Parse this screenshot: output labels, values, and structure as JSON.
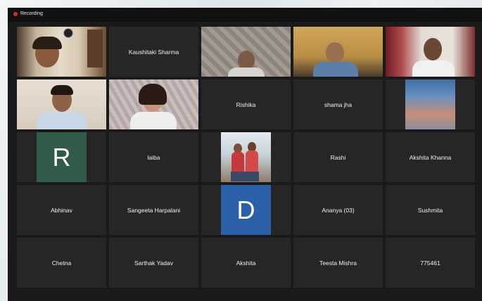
{
  "recording": {
    "label": "Recording"
  },
  "colors": {
    "active_border": "#8bc33f",
    "tile_bg": "#262626",
    "avatar_R": "#2f5b48",
    "avatar_D": "#2b5fa8",
    "recording_dot": "#e02828"
  },
  "tiles": [
    {
      "kind": "video",
      "name": ""
    },
    {
      "kind": "name",
      "name": "Kaushitaki Sharma"
    },
    {
      "kind": "video",
      "name": ""
    },
    {
      "kind": "video",
      "name": ""
    },
    {
      "kind": "video",
      "name": ""
    },
    {
      "kind": "video",
      "name": ""
    },
    {
      "kind": "video",
      "name": ""
    },
    {
      "kind": "name",
      "name": "Rishika"
    },
    {
      "kind": "name",
      "name": "shama jha"
    },
    {
      "kind": "image",
      "name": ""
    },
    {
      "kind": "avatar",
      "letter": "R"
    },
    {
      "kind": "name",
      "name": "laiba"
    },
    {
      "kind": "image",
      "name": ""
    },
    {
      "kind": "name",
      "name": "Rashi"
    },
    {
      "kind": "name",
      "name": "Akshita Khanna"
    },
    {
      "kind": "name",
      "name": "Abhinav"
    },
    {
      "kind": "name",
      "name": "Sangeeta Harpalani"
    },
    {
      "kind": "avatar",
      "letter": "D"
    },
    {
      "kind": "name",
      "name": "Ananya (03)"
    },
    {
      "kind": "name",
      "name": "Sushmita"
    },
    {
      "kind": "name",
      "name": "Chetna"
    },
    {
      "kind": "name",
      "name": "Sarthak Yadav"
    },
    {
      "kind": "name",
      "name": "Akshita"
    },
    {
      "kind": "name",
      "name": "Teesta Mishra"
    },
    {
      "kind": "name",
      "name": "775461"
    }
  ]
}
